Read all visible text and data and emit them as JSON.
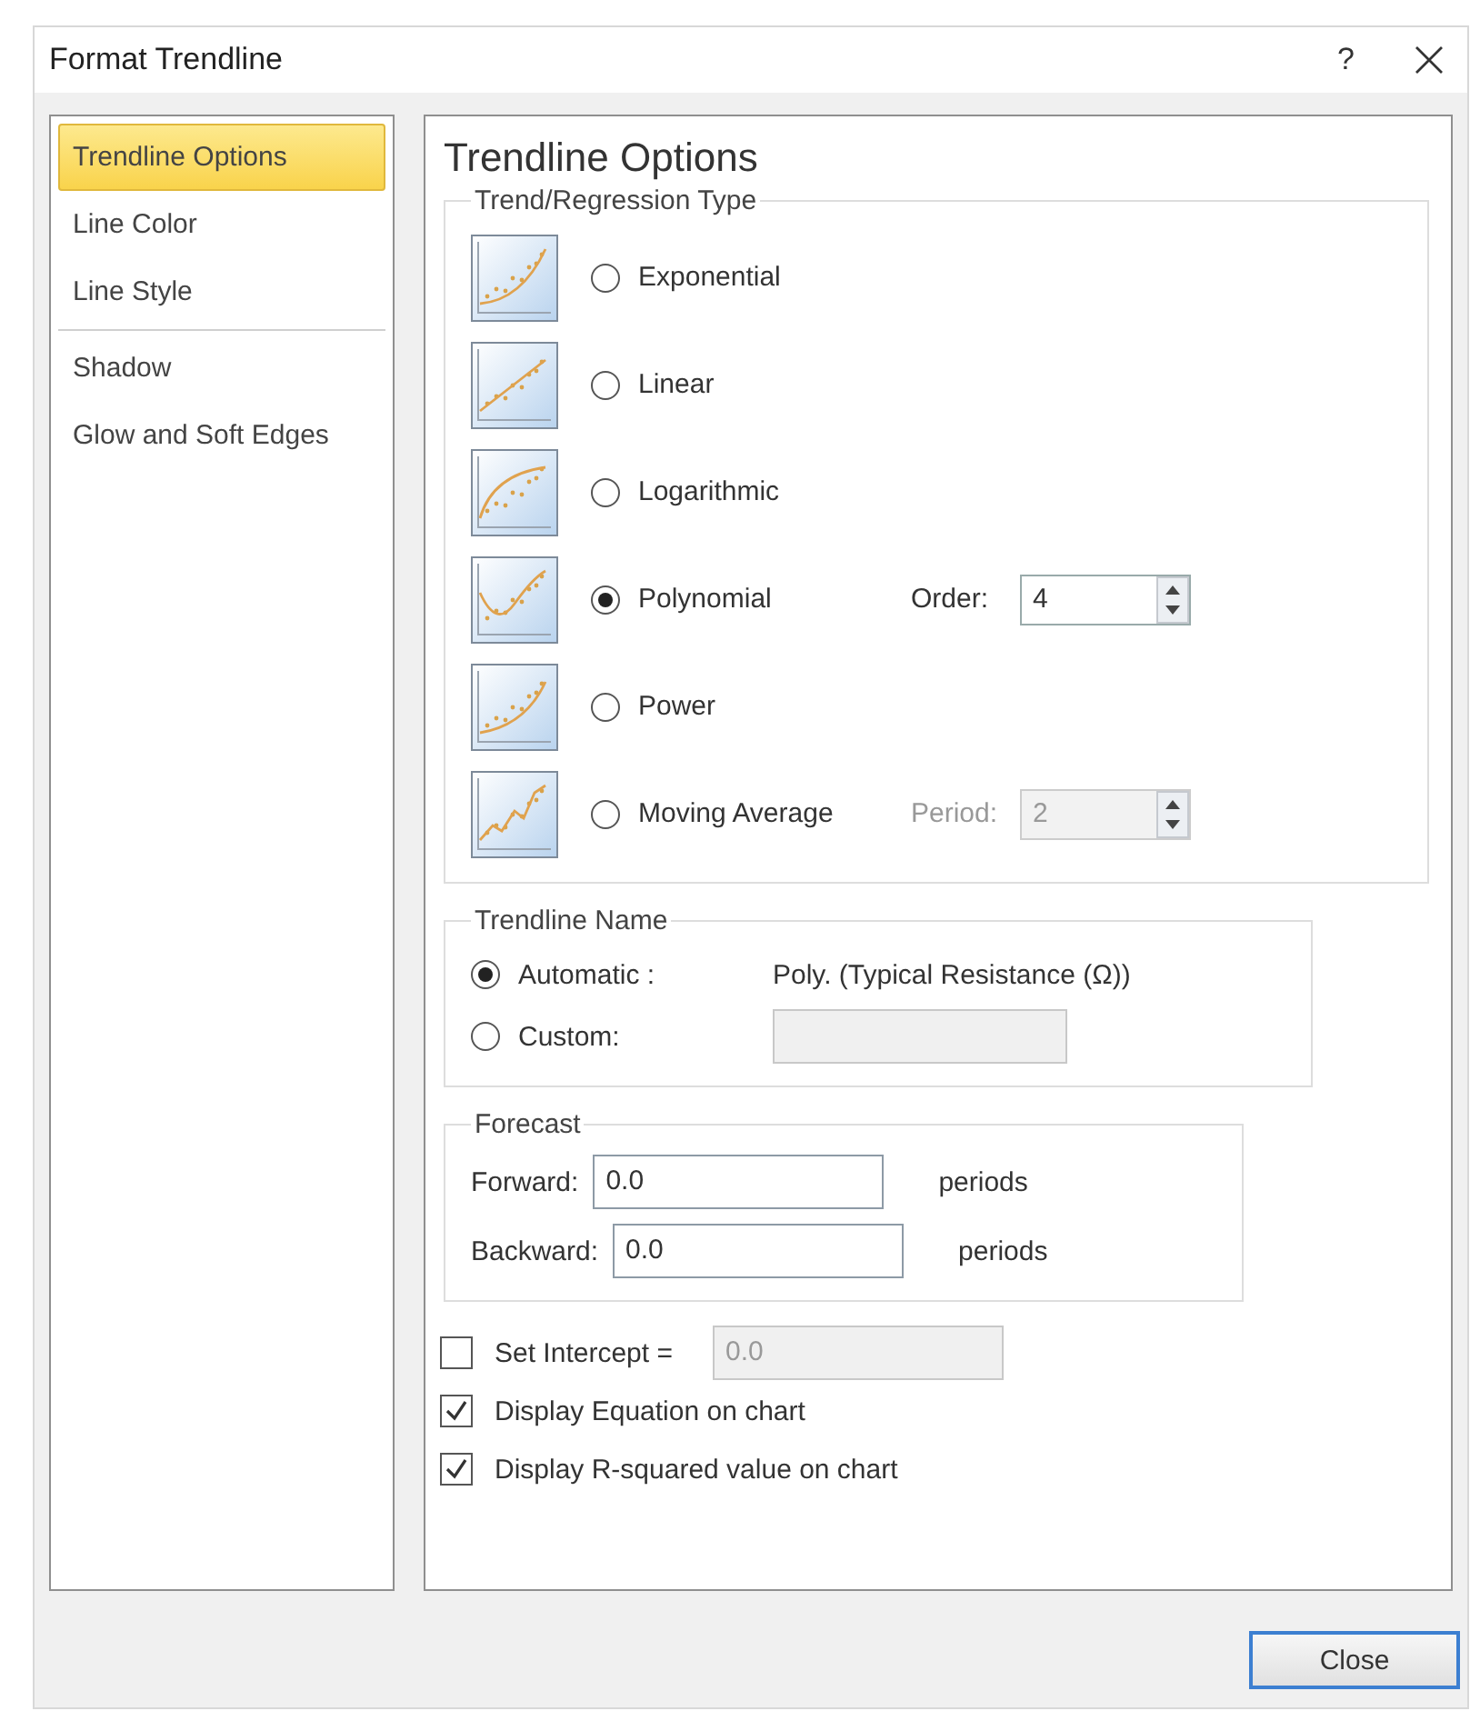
{
  "window": {
    "title": "Format Trendline",
    "help": "?"
  },
  "sidebar": {
    "groups": [
      [
        {
          "label": "Trendline Options",
          "selected": true
        },
        {
          "label": "Line Color",
          "selected": false
        },
        {
          "label": "Line Style",
          "selected": false
        }
      ],
      [
        {
          "label": "Shadow",
          "selected": false
        },
        {
          "label": "Glow and Soft Edges",
          "selected": false
        }
      ]
    ]
  },
  "heading": "Trendline Options",
  "regression": {
    "legend": "Trend/Regression Type",
    "types": [
      {
        "kind": "exponential",
        "label": "Exponential",
        "selected": false
      },
      {
        "kind": "linear",
        "label": "Linear",
        "selected": false
      },
      {
        "kind": "logarithmic",
        "label": "Logarithmic",
        "selected": false
      },
      {
        "kind": "polynomial",
        "label": "Polynomial",
        "selected": true,
        "param": {
          "label": "Order:",
          "value": "4",
          "disabled": false
        }
      },
      {
        "kind": "power",
        "label": "Power",
        "selected": false
      },
      {
        "kind": "moving_average",
        "label": "Moving Average",
        "selected": false,
        "param": {
          "label": "Period:",
          "value": "2",
          "disabled": true
        }
      }
    ]
  },
  "trendline_name": {
    "legend": "Trendline Name",
    "options": [
      {
        "label": "Automatic :",
        "selected": true,
        "value": "Poly. (Typical Resistance (Ω))"
      },
      {
        "label": "Custom:",
        "selected": false,
        "field": {
          "disabled": true
        }
      }
    ]
  },
  "forecast": {
    "legend": "Forecast",
    "rows": [
      {
        "label": "Forward:",
        "value": "0.0",
        "unit": "periods"
      },
      {
        "label": "Backward:",
        "value": "0.0",
        "unit": "periods"
      }
    ]
  },
  "options": [
    {
      "label": "Set Intercept =",
      "checked": false,
      "field": {
        "value": "0.0",
        "disabled": true
      }
    },
    {
      "label": "Display Equation on chart",
      "checked": true
    },
    {
      "label": "Display R-squared value on chart",
      "checked": true
    }
  ],
  "buttons": [
    "Close"
  ]
}
